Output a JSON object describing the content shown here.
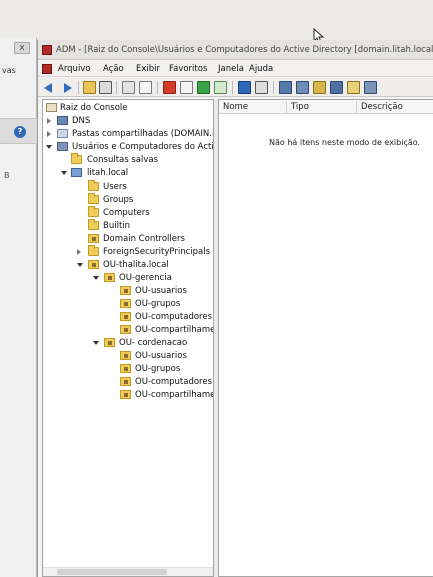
{
  "window": {
    "title": "ADM - [Raiz do Console\\Usuários e Computadores do Active Directory [domain.litah.local]\\litah.local\\"
  },
  "background_window": {
    "close_glyph": "x",
    "partial_text": "vas",
    "help_glyph": "?",
    "partial_letter": "B"
  },
  "menu": [
    "Arquivo",
    "Ação",
    "Exibir",
    "Favoritos",
    "Janela",
    "Ajuda"
  ],
  "toolbar_icons": [
    "back-icon",
    "forward-icon",
    "up-folder-icon",
    "show-tree-icon",
    "cut-icon",
    "copy-icon",
    "delete-icon",
    "properties-icon",
    "refresh-icon",
    "export-icon",
    "help-icon",
    "view-icon",
    "users-icon",
    "add-user-icon",
    "group-icon",
    "filter-icon",
    "new-ou-icon",
    "find-icon"
  ],
  "tree": {
    "root": "Raiz do Console",
    "dns": "DNS",
    "shared": "Pastas compartilhadas (DOMAIN.L",
    "aduc": "Usuários e Computadores do Activ",
    "saved": "Consultas salvas",
    "domain": "litah.local",
    "users": "Users",
    "groups": "Groups",
    "computers": "Computers",
    "builtin": "Builtin",
    "dc": "Domain Controllers",
    "fsp": "ForeignSecurityPrincipals",
    "ou_main": "OU-thalita.local",
    "ou_gerencia": "OU-gerencia",
    "g_usuarios": "OU-usuarios",
    "g_grupos": "OU-grupos",
    "g_computadores": "OU-computadores",
    "g_compart": "OU-compartilhamer",
    "ou_cordenacao": "OU- cordenacao",
    "c_usuarios": "OU-usuarios",
    "c_grupos": "OU-grupos",
    "c_computadores": "OU-computadores",
    "c_compart": "OU-compartilhamer"
  },
  "list": {
    "columns": [
      "Nome",
      "Tipo",
      "Descrição"
    ],
    "empty_message": "Não há itens neste modo de exibição."
  }
}
